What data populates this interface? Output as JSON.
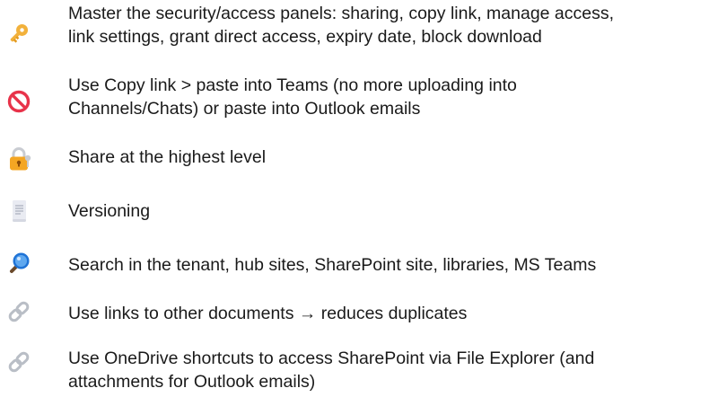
{
  "items": [
    {
      "icon": "key-icon",
      "lines": [
        "Master the security/access panels: sharing, copy link, manage access,",
        "link settings, grant direct access, expiry date, block download"
      ]
    },
    {
      "icon": "prohibited-icon",
      "lines": [
        "Use Copy link > paste into Teams (no more uploading into",
        "Channels/Chats) or paste into Outlook emails"
      ]
    },
    {
      "icon": "locked-with-key-icon",
      "lines": [
        "Share at the highest level"
      ]
    },
    {
      "icon": "document-scroll-icon",
      "lines": [
        "Versioning"
      ]
    },
    {
      "icon": "magnifying-glass-icon",
      "lines": [
        "Search in the tenant, hub sites, SharePoint site, libraries, MS Teams"
      ]
    },
    {
      "icon": "link-icon",
      "lines": [
        "Use links to other documents → reduces duplicates"
      ]
    },
    {
      "icon": "link-icon",
      "lines": [
        "Use OneDrive shortcuts to access SharePoint via File Explorer (and",
        "attachments for Outlook emails)"
      ]
    }
  ],
  "colors": {
    "text": "#1a1a1a",
    "key": "#f2b13b",
    "prohibited": "#e8334a",
    "lock": "#f4a623",
    "magnifier": "#1f73d6",
    "link": "#b9bec6"
  }
}
